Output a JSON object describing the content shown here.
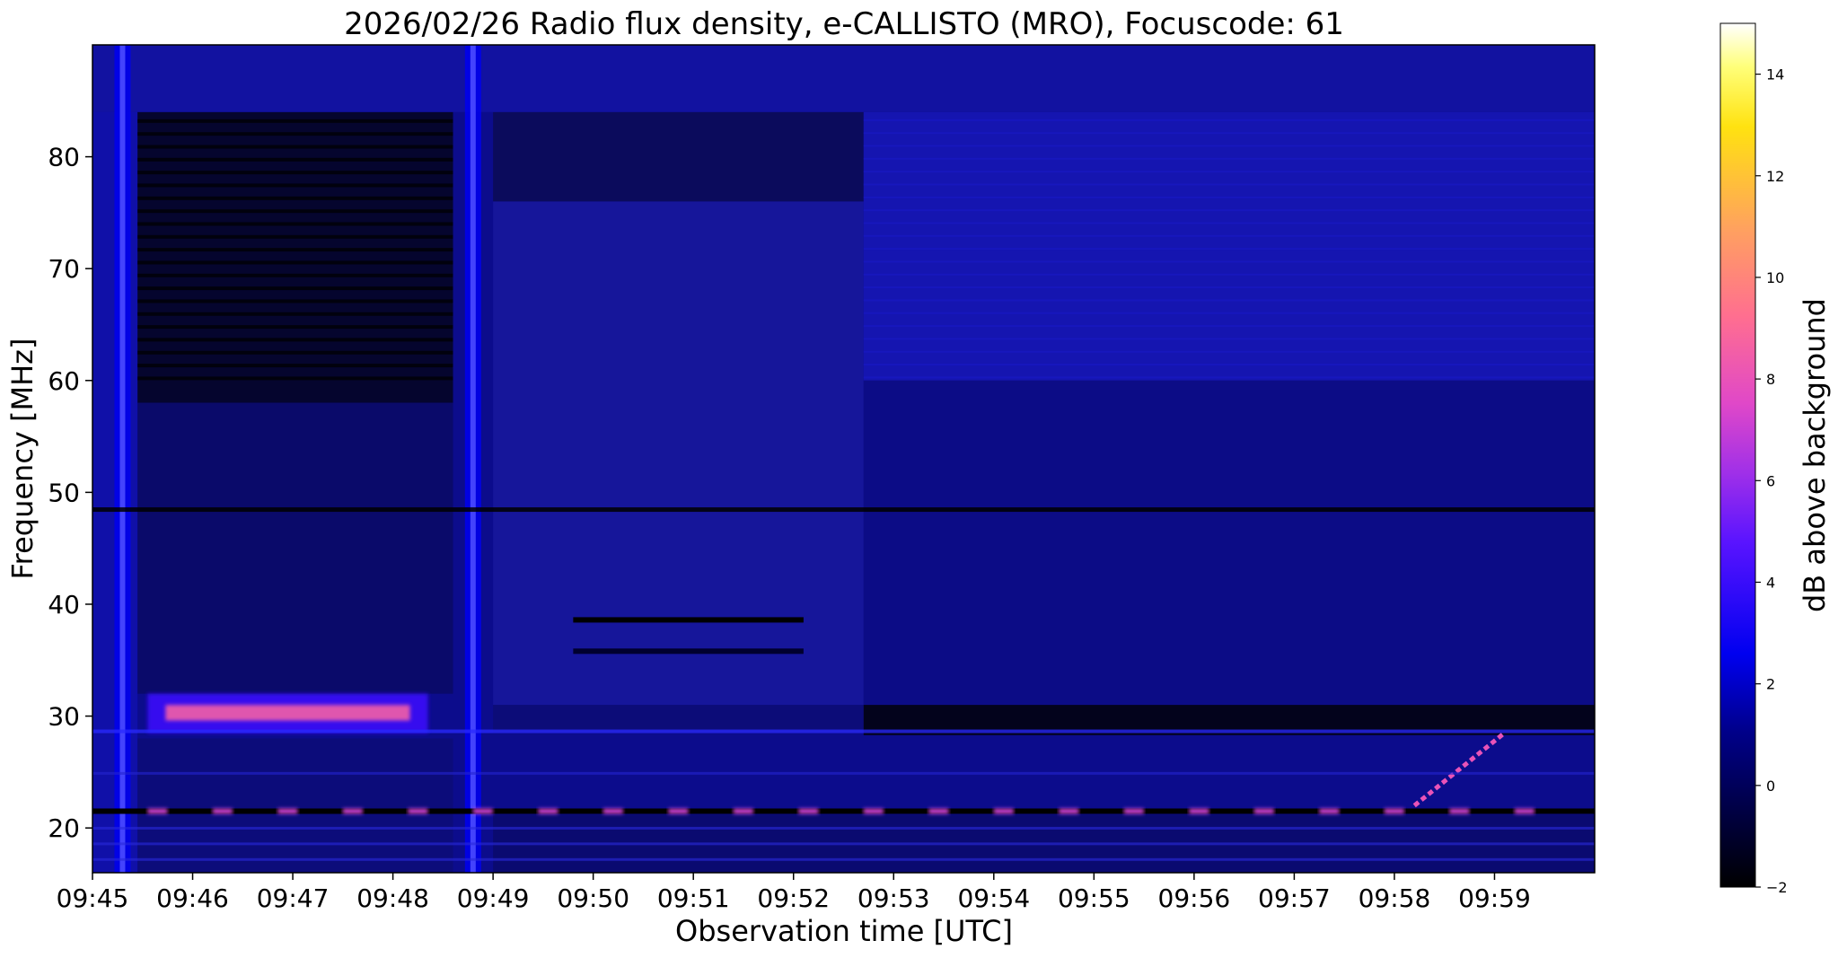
{
  "chart_data": [
    {
      "type": "heatmap",
      "title": "2026/02/26  Radio flux density, e-CALLISTO (MRO), Focuscode: 61",
      "xlabel": "Observation time [UTC]",
      "ylabel": "Frequency [MHz]",
      "x_ticks": [
        "09:45",
        "09:46",
        "09:47",
        "09:48",
        "09:49",
        "09:50",
        "09:51",
        "09:52",
        "09:53",
        "09:54",
        "09:55",
        "09:56",
        "09:57",
        "09:58",
        "09:59"
      ],
      "xlim_minutes": [
        0,
        15
      ],
      "y_ticks": [
        20,
        30,
        40,
        50,
        60,
        70,
        80
      ],
      "ylim": [
        16,
        90
      ],
      "colormap": "gnuplot2",
      "features": [
        {
          "kind": "broadband_spike",
          "t_min": 0.3,
          "value_db": 2.5
        },
        {
          "kind": "broadband_spike",
          "t_min": 3.8,
          "value_db": 2.5
        },
        {
          "kind": "emission_band",
          "t_start": 0.55,
          "t_end": 3.35,
          "f_low": 28.5,
          "f_high": 32,
          "value_db": 6
        },
        {
          "kind": "hline_bright",
          "t_start": 0,
          "t_end": 15,
          "freq": 21.5,
          "value_db": 4
        },
        {
          "kind": "hline_mid",
          "t_start": 0,
          "t_end": 15,
          "freq": 48.5,
          "value_db": 0.5
        },
        {
          "kind": "drift_burst",
          "t_start": 13.2,
          "t_end": 14.1,
          "f_start": 22,
          "f_end": 28.5,
          "value_db": 5
        },
        {
          "kind": "dark_line",
          "t_start": 4.8,
          "t_end": 7.1,
          "freq": 38.6,
          "value_db": -2
        },
        {
          "kind": "dark_line",
          "t_start": 4.8,
          "t_end": 7.1,
          "freq": 35.8,
          "value_db": -1
        }
      ]
    },
    {
      "type": "colorbar",
      "label": "dB above background",
      "colormap": "gnuplot2",
      "range": [
        -2,
        15
      ],
      "ticks": [
        -2,
        0,
        2,
        4,
        6,
        8,
        10,
        12,
        14
      ]
    }
  ]
}
